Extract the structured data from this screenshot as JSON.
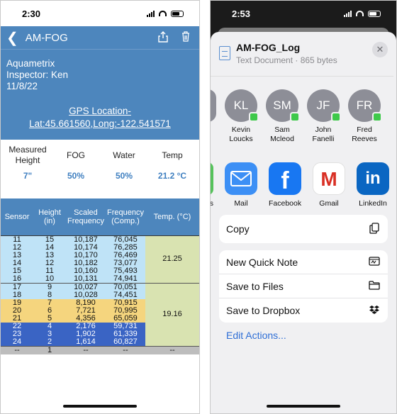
{
  "left": {
    "status": {
      "time": "2:30"
    },
    "nav": {
      "back_glyph": "❮",
      "title": "AM-FOG"
    },
    "info": {
      "company": "Aquametrix",
      "inspector": "Inspector: Ken",
      "date": "11/8/22",
      "gps_line1": "GPS Location-",
      "gps_line2": "Lat:45.661560,Long:-122.541571"
    },
    "readings": {
      "labels": [
        "Measured Height",
        "FOG",
        "Water",
        "Temp"
      ],
      "values": [
        "7\"",
        "50%",
        "50%",
        "21.2 °C"
      ]
    },
    "table": {
      "headers": [
        "Sensor",
        "Height (in)",
        "Scaled Frequency",
        "Frequency (Comp.)",
        "Temp. (°C)"
      ],
      "temps": [
        "21.25",
        "19.16"
      ],
      "rows": [
        [
          "11",
          "15",
          "10,187",
          "76,045"
        ],
        [
          "12",
          "14",
          "10,174",
          "76,285"
        ],
        [
          "13",
          "13",
          "10,170",
          "76,469"
        ],
        [
          "14",
          "12",
          "10,182",
          "73,077"
        ],
        [
          "15",
          "11",
          "10,160",
          "75,493"
        ],
        [
          "16",
          "10",
          "10,131",
          "74,941"
        ],
        [
          "17",
          "9",
          "10,027",
          "70,051"
        ],
        [
          "18",
          "8",
          "10,028",
          "74,451"
        ],
        [
          "19",
          "7",
          "8,190",
          "70,915"
        ],
        [
          "20",
          "6",
          "7,721",
          "70,995"
        ],
        [
          "21",
          "5",
          "4,356",
          "65,059"
        ],
        [
          "22",
          "4",
          "2,176",
          "59,731"
        ],
        [
          "23",
          "3",
          "1,902",
          "61,339"
        ],
        [
          "24",
          "2",
          "1,614",
          "60,827"
        ],
        [
          "--",
          "1",
          "--",
          "--",
          "--"
        ]
      ],
      "row_colors": [
        "#bfe3f7",
        "#bfe3f7",
        "#bfe3f7",
        "#bfe3f7",
        "#bfe3f7",
        "#bfe3f7",
        "#bfe3f7",
        "#bfe3f7",
        "#f5d57e",
        "#f5d57e",
        "#f5d57e",
        "#3a64c4",
        "#3a64c4",
        "#3a64c4",
        "#bdbdbd"
      ]
    }
  },
  "right": {
    "status": {
      "time": "2:53"
    },
    "file": {
      "name": "AM-FOG_Log",
      "meta": "Text Document · 865 bytes"
    },
    "people": [
      {
        "initials": "KL",
        "name_line1": "Kevin",
        "name_line2": "Loucks"
      },
      {
        "initials": "SM",
        "name_line1": "Sam",
        "name_line2": "Mcleod"
      },
      {
        "initials": "JF",
        "name_line1": "John",
        "name_line2": "Fanelli"
      },
      {
        "initials": "FR",
        "name_line1": "Fred",
        "name_line2": "Reeves"
      }
    ],
    "apps": [
      {
        "name": "Mail",
        "glyph": "✉",
        "color": "#3c8ff5"
      },
      {
        "name": "Facebook",
        "glyph": "f",
        "color": "#1877f2"
      },
      {
        "name": "Gmail",
        "glyph": "M",
        "color": "#ffffff"
      },
      {
        "name": "LinkedIn",
        "glyph": "in",
        "color": "#0a66c2"
      }
    ],
    "partial_app_label": "es",
    "actions": {
      "copy": "Copy",
      "quick_note": "New Quick Note",
      "save_files": "Save to Files",
      "save_dropbox": "Save to Dropbox",
      "edit": "Edit Actions..."
    },
    "close_glyph": "✕"
  }
}
